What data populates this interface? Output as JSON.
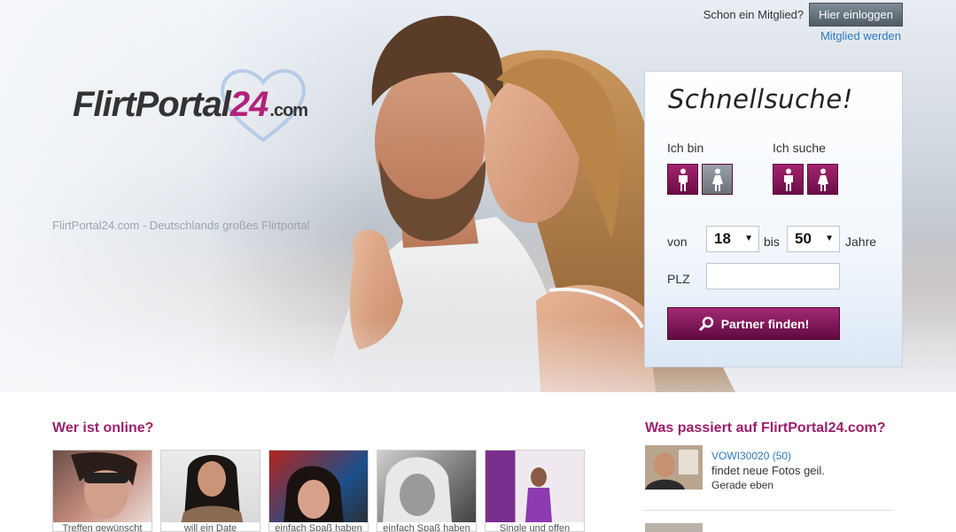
{
  "header": {
    "already_member": "Schon ein Mitglied?",
    "login_button": "Hier einloggen",
    "register_link": "Mitglied werden"
  },
  "logo": {
    "main": "FlirtPortal",
    "number": "24",
    "domain": ".com"
  },
  "tagline": "FlirtPortal24.com - Deutschlands großes Flirtportal",
  "search": {
    "title": "Schnellsuche!",
    "i_am": "Ich bin",
    "looking_for": "Ich suche",
    "from_label": "von",
    "from_value": "18",
    "to_label": "bis",
    "to_value": "50",
    "years_label": "Jahre",
    "plz_label": "PLZ",
    "plz_value": "",
    "submit": "Partner finden!"
  },
  "online": {
    "title": "Wer ist online?",
    "thumbs": [
      {
        "caption": "Treffen gewünscht"
      },
      {
        "caption": "will ein Date"
      },
      {
        "caption": "einfach Spaß haben"
      },
      {
        "caption": "einfach Spaß haben"
      },
      {
        "caption": "Single und offen"
      }
    ]
  },
  "activity": {
    "title": "Was passiert auf FlirtPortal24.com?",
    "items": [
      {
        "user": "VOWI30020 (50)",
        "text": "findet neue Fotos geil.",
        "time": "Gerade eben"
      }
    ]
  },
  "colors": {
    "brand_pink": "#9b1f6c",
    "link_blue": "#2b7bbf"
  }
}
